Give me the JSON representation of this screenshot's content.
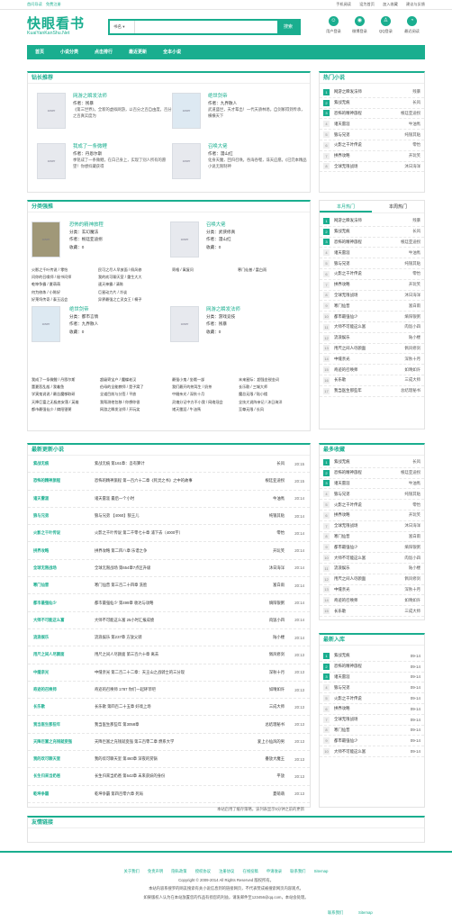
{
  "topbar": {
    "left": "首问导读　免费注册",
    "right": [
      "手机阅读",
      "设为首页",
      "加入收藏",
      "建议与反馈"
    ]
  },
  "header": {
    "logo_cn": "快眼看书",
    "logo_en": "KuaiYanKanShu.Net",
    "search_sel": "书名",
    "search_btn": "搜索",
    "icons": [
      {
        "label": "用户登录",
        "icon": "user-icon"
      },
      {
        "label": "微博登录",
        "icon": "weibo-icon"
      },
      {
        "label": "QQ登录",
        "icon": "qq-icon"
      },
      {
        "label": "最近阅读",
        "icon": "clock-icon"
      }
    ]
  },
  "nav": [
    "首页",
    "小说分类",
    "点击排行",
    "最近更新",
    "全本小说"
  ],
  "featured": {
    "title": "钻长推荐",
    "books": [
      {
        "title": "网游之瞬发法师",
        "author": "作者：残暴",
        "desc": "《第三世界》，全新的虚拟网游，以百分之百自由度，百分之百真实度为"
      },
      {
        "title": "绝世剑帝",
        "author": "作者：九界散人",
        "desc": "武道盛世，天才辈出！一代天骄林易，自剑冢得到传承，横横天下"
      },
      {
        "title": "我成了一条微鲤",
        "author": "作者：丹恩尔斯",
        "desc": "季铭成了一条微鲤，在白己身上，实现了别人所有的愿望！你想抖藏获得"
      },
      {
        "title": "召唤大佬",
        "author": "作者：漫山红",
        "desc": "化身天魔，回归召唤。吞海吞噬，诛天应愿。《已完本精品小说无限制神"
      }
    ]
  },
  "category": {
    "title": "分类强推",
    "books": [
      {
        "title": "恐怖的精神旅程",
        "author": "分类：玄幻魔法",
        "writer": "作者：根廷亚迪拐",
        "clicks": "收藏：0"
      },
      {
        "title": "召唤大佬",
        "author": "分类：武侠修真",
        "writer": "作者：漫山红",
        "clicks": "收藏：0"
      },
      {
        "title": "绝世剑帝",
        "author": "分类：都市言情",
        "writer": "作者：九界散人",
        "clicks": "收藏：0"
      },
      {
        "title": "网游之瞬发法师",
        "author": "分类：游戏竞技",
        "writer": "作者：残暴",
        "clicks": "收藏：0"
      }
    ],
    "links1": [
      "火影之千叶传说 / 零怡",
      "问你的召唤师 / 秘书问师",
      "乾坤争霸 / 夏萌萌",
      "何为修炼 / 小陈好",
      "好莱坞传奇 / 泰玉远会"
    ],
    "links2": [
      "民可之尽人早放面 / 佩风修",
      "我的欢可聊天室 / 重生大大",
      "速天神霸 / 清陈",
      "巨星动力片 / 冷谈",
      "异界最强之亡灵女王 / 桐子"
    ],
    "links3": [
      "寄格 / 寓复问",
      "",
      "",
      "",
      ""
    ],
    "links4": [
      "寒门仙普 / 富白雨",
      "",
      "",
      "",
      ""
    ],
    "links5": [
      "我成了一条微鲤 / 丹恩尔斯",
      "董夏悲乱般 / 我着鱼",
      "学寅鬼说说 / 最告魔嗲取研",
      "天降巨富之无极底安落 / 英雄",
      "都市最强仙少 / 熵阳银粥"
    ],
    "links6": [
      "超级寄宝户 / 魔蝶老汉",
      "伯母的全能教师 / 是子窝了",
      "全道目前与分签 / 平放",
      "我帮测他包移 / 你想你很",
      "网游之瞬发法师 / 开玩笑"
    ],
    "links7": [
      "最强小鬼 / 坐哦一部",
      "我们最开的热驾生 / 奶茶",
      "中缝亲光 / 深秋十月",
      "灵魂分记中方不小我 / 网络冠会",
      "诸天雷涯 / 牛油馬"
    ],
    "links8": [
      "末来星际：超强金锐金词",
      "长乐歌 / 三城大师",
      "魔总无限 / 陆小楼",
      "全技大说阵亲记 / 沐日海洋",
      "至尊无限 / 长风"
    ]
  },
  "updates": {
    "title": "最新更新小说",
    "note": "本站启用了缓存策略，该列表显示5分钟之前的更新",
    "rows": [
      [
        "紫战无痕",
        "紫战无痕 第161章：吾有算计",
        "长风",
        "20:15"
      ],
      [
        "恐怖的精神旅程",
        "恐怖的精神旅程 第一百六十二章《死灵之书》之中的故事",
        "根廷亚迪拐",
        "20:15"
      ],
      [
        "诸天雷涯",
        "诸天雷涯 最后一个小时",
        "牛油馬",
        "20:14"
      ],
      [
        "狼与兄弟",
        "狼与兄弟 【4060】狼王儿",
        "纯银其贴",
        "20:14"
      ],
      [
        "火影之千叶传说",
        "火影之千叶传说 第二千零七十章 浦下去（4000字）",
        "零怡",
        "20:14"
      ],
      [
        "拼界攻略",
        "拼界攻略 第二四八章 乐谱之争",
        "开玩笑",
        "20:14"
      ],
      [
        "全球无限战场",
        "全球无限战场 第654章7点区升级",
        "沐日海洋",
        "20:14"
      ],
      [
        "寒门仙普",
        "寒门仙普 第三百二十四章 洗脸",
        "富白雨",
        "20:14"
      ],
      [
        "都市最强仙少",
        "都市最强仙少 第499章 收达与攻略",
        "熵阳银粥",
        "20:14"
      ],
      [
        "大师不可能这么富",
        "大师不可能这么富 25小时汇报成绩",
        "肉饭小四",
        "20:14"
      ],
      [
        "流浪娱乐",
        "流浪娱乐 第237章 方放父骑",
        "陆小楼",
        "20:14"
      ],
      [
        "用尺之间人尽颜面",
        "用尺之间人尽颜面 第三百六十章 离去",
        "佩风修剑",
        "20:13"
      ],
      [
        "中缝亲光",
        "中缝亲光 第二百二十二章：天王山之战骑士的三分现",
        "深秋十月",
        "20:13"
      ],
      [
        "奇迹的召唤师",
        "奇迹的召唤师 1787 你们一起砰苹吧",
        "如晴如许",
        "20:13"
      ],
      [
        "长乐歌",
        "长乐歌 第四百二十五章 好戏上场",
        "三成大师",
        "20:13"
      ],
      [
        "我当医生那些年",
        "我当医生那些年 第3058章",
        "总结理秘书",
        "20:13"
      ],
      [
        "天降巨富之充钱就变强",
        "天降巨富之充钱就变强 第三百零二章 燃系大学",
        "爱上小仙风的男",
        "20:13"
      ],
      [
        "我的欢可聊天室",
        "我的欢可聊天室 第460章 深夜的赏锅",
        "番放大魔王",
        "20:13"
      ],
      [
        "长生归来当奶爸",
        "长生归来当奶爸 第642章 末来获妖的身份",
        "平放",
        "20:13"
      ],
      [
        "乾坤争霸",
        "乾坤争霸 第四百零六章 死局",
        "夏萌萌",
        "20:13"
      ]
    ]
  },
  "hot": {
    "title": "热门小说",
    "rows": [
      [
        "网游之瞬发法师",
        "残暴"
      ],
      [
        "紫战无痕",
        "长风"
      ],
      [
        "恐怖的精神旅程",
        "根廷亚迪拐"
      ],
      [
        "诸天雷涯",
        "牛油馬"
      ],
      [
        "狼与兄弟",
        "纯银其贴"
      ],
      [
        "火影之千叶传说",
        "零怡"
      ],
      [
        "拼界攻略",
        "开玩笑"
      ],
      [
        "全球无限战场",
        "沐日海洋"
      ]
    ]
  },
  "monthly": {
    "tab1": "本月热门",
    "tab2": "本周热门",
    "rows": [
      [
        "网游之瞬发法师",
        "残暴"
      ],
      [
        "紫战无痕",
        "长风"
      ],
      [
        "恐怖的精神旅程",
        "根廷亚迪拐"
      ],
      [
        "诸天雷涯",
        "牛油馬"
      ],
      [
        "狼与兄弟",
        "纯银其贴"
      ],
      [
        "火影之千叶传说",
        "零怡"
      ],
      [
        "拼界攻略",
        "开玩笑"
      ],
      [
        "全球无限战场",
        "沐日海洋"
      ],
      [
        "寒门仙普",
        "富白雨"
      ],
      [
        "都市最强仙少",
        "熵阳银粥"
      ],
      [
        "大师不可能这么富",
        "肉饭小四"
      ],
      [
        "流浪娱乐",
        "陆小楼"
      ],
      [
        "用尺之间人尽颜面",
        "佩风修剑"
      ],
      [
        "中缝亲光",
        "深秋十月"
      ],
      [
        "奇迹的召唤师",
        "如晴如许"
      ],
      [
        "长乐歌",
        "三成大师"
      ],
      [
        "我当医生那些年",
        "总结理秘书"
      ]
    ]
  },
  "favorites": {
    "title": "最多收藏",
    "rows": [
      [
        "紫战无痕",
        "长风"
      ],
      [
        "恐怖的精神旅程",
        "根廷亚迪拐"
      ],
      [
        "诸天雷涯",
        "牛油馬"
      ],
      [
        "狼与兄弟",
        "纯银其贴"
      ],
      [
        "火影之千叶传说",
        "零怡"
      ],
      [
        "拼界攻略",
        "开玩笑"
      ],
      [
        "全球无限战场",
        "沐日海洋"
      ],
      [
        "寒门仙普",
        "富白雨"
      ],
      [
        "都市最强仙少",
        "熵阳银粥"
      ],
      [
        "大师不可能这么富",
        "肉饭小四"
      ],
      [
        "流浪娱乐",
        "陆小楼"
      ],
      [
        "用尺之间人尽颜面",
        "佩风修剑"
      ],
      [
        "中缝亲光",
        "深秋十月"
      ],
      [
        "奇迹的召唤师",
        "如晴如许"
      ],
      [
        "长乐歌",
        "三成大师"
      ]
    ]
  },
  "newest": {
    "title": "最新入库",
    "rows": [
      [
        "紫战无痕",
        "09-14"
      ],
      [
        "恐怖的精神旅程",
        "09-14"
      ],
      [
        "诸天雷涯",
        "09-14"
      ],
      [
        "狼与兄弟",
        "09-14"
      ],
      [
        "火影之千叶传说",
        "09-14"
      ],
      [
        "拼界攻略",
        "09-14"
      ],
      [
        "全球无限战场",
        "09-14"
      ],
      [
        "寒门仙普",
        "09-14"
      ],
      [
        "都市最强仙少",
        "09-14"
      ],
      [
        "大师不可能这么富",
        "09-14"
      ]
    ]
  },
  "friends": {
    "title": "友情链接"
  },
  "footer": {
    "links": [
      "关于我们",
      "免责声明",
      "隐私政策",
      "授权协议",
      "注册协议",
      "在线投稿",
      "申请收录",
      "联系我们",
      "Sitemap"
    ],
    "copy": "Copyright © 2009-2014 All Rights Reserved 版权所有。",
    "line2": "本站内容系搜罗的网友搜索有关小说信息到的链接网页，不代表赞成被搜索网页内容观点。",
    "line3": "如果版权人认为在本站放置您的作品有损您的利益，请发邮件至123456@qq.com，本站会处理。",
    "float1": "联系我们",
    "float2": "Sitemap"
  }
}
